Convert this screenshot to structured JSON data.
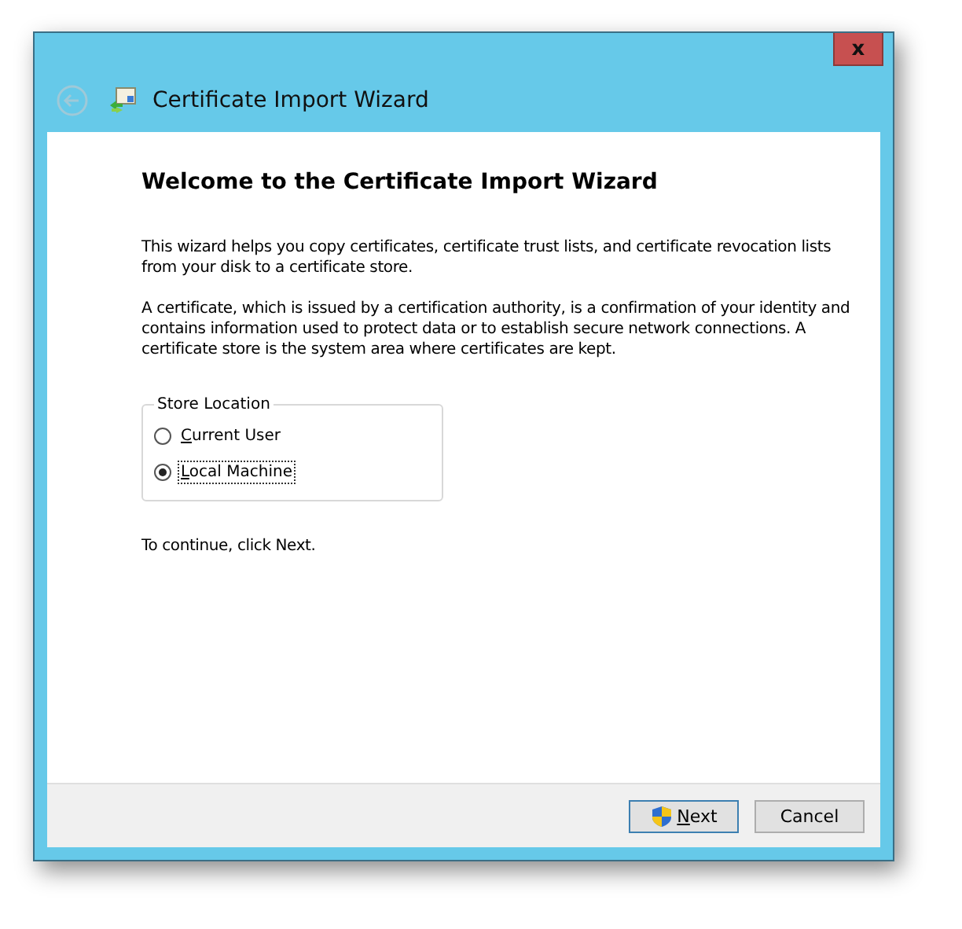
{
  "window": {
    "title": "Certificate Import Wizard",
    "close": "x"
  },
  "heading": "Welcome to the Certificate Import Wizard",
  "paragraphs": [
    "This wizard helps you copy certificates, certificate trust lists, and certificate revocation lists from your disk to a certificate store.",
    "A certificate, which is issued by a certification authority, is a confirmation of your identity and contains information used to protect data or to establish secure network connections. A certificate store is the system area where certificates are kept."
  ],
  "store_location": {
    "label": "Store Location",
    "options": [
      {
        "label": "Current User",
        "selected": false
      },
      {
        "label": "Local Machine",
        "selected": true
      }
    ]
  },
  "hint": "To continue, click Next.",
  "buttons": [
    {
      "label": "Next",
      "kind": "shield"
    },
    {
      "label": "Cancel",
      "kind": "plain"
    }
  ]
}
